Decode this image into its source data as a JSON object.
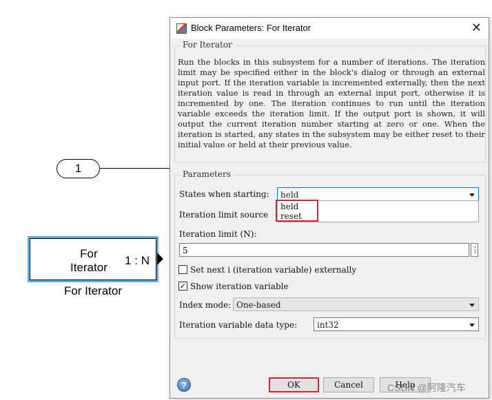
{
  "canvas": {
    "inport_number": "1",
    "block_name_line1": "For",
    "block_name_line2": "Iterator",
    "block_port_label": "1 : N",
    "block_caption": "For Iterator"
  },
  "dialog": {
    "title": "Block Parameters: For Iterator",
    "group_title": "For Iterator",
    "description": "Run the blocks in this subsystem for a number of iterations.  The iteration limit may be specified either in the block's dialog or through an external input port.  If the iteration variable is incremented externally, then the next iteration value is read in through an external input port, otherwise it is incremented by one. The iteration continues to run until the iteration variable exceeds the iteration limit.  If the output port is shown, it will output the current iteration number starting at zero or one.  When the iteration is started, any states in the subsystem may be either reset to their initial value or held at their previous value.",
    "params_title": "Parameters",
    "states_label": "States when starting:",
    "states_value": "held",
    "states_options": [
      "held",
      "reset"
    ],
    "limit_source_label": "Iteration limit source",
    "limit_label": "Iteration limit (N):",
    "limit_value": "5",
    "kebab": "⋮",
    "set_next_label": "Set next i (iteration variable) externally",
    "set_next_checked": false,
    "show_var_label": "Show iteration variable",
    "show_var_checked": true,
    "index_mode_label": "Index mode:",
    "index_mode_value": "One-based",
    "dtype_label": "Iteration variable data type:",
    "dtype_value": "int32",
    "ok": "OK",
    "cancel": "Cancel",
    "help": "Help",
    "watermark": "CSDN @阿隆汽车"
  },
  "colors": {
    "selection_blue": "#5aaee6",
    "highlight_red": "#d9232e",
    "dialog_bg": "#f0f0f0"
  }
}
